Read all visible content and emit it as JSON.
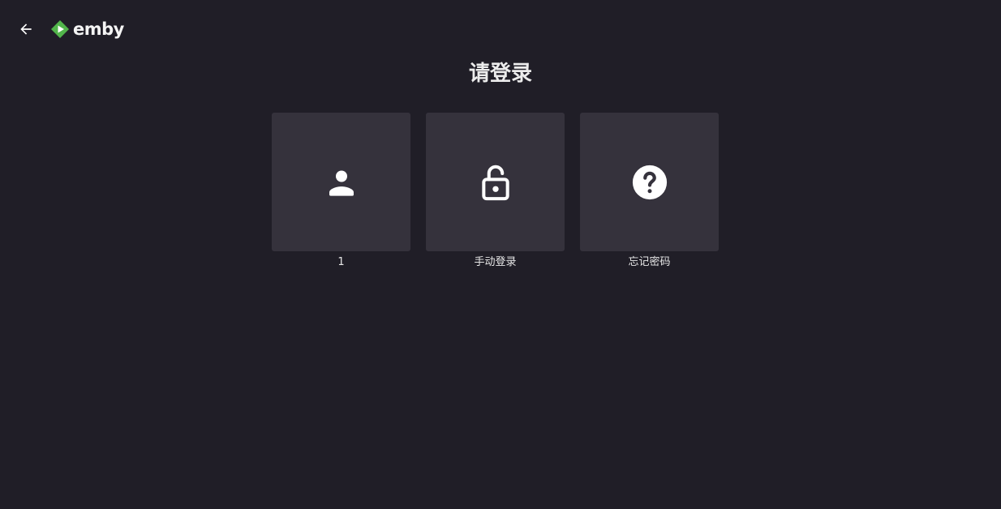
{
  "header": {
    "back_icon": "arrow-left-icon",
    "logo_text": "emby",
    "logo_color": "#52b54b"
  },
  "title": "请登录",
  "cards": [
    {
      "label": "1",
      "icon": "person-icon"
    },
    {
      "label": "手动登录",
      "icon": "lock-open-icon"
    },
    {
      "label": "忘记密码",
      "icon": "help-circle-icon"
    }
  ],
  "colors": {
    "background": "#201e27",
    "card": "#35323c",
    "text": "#ffffff"
  }
}
